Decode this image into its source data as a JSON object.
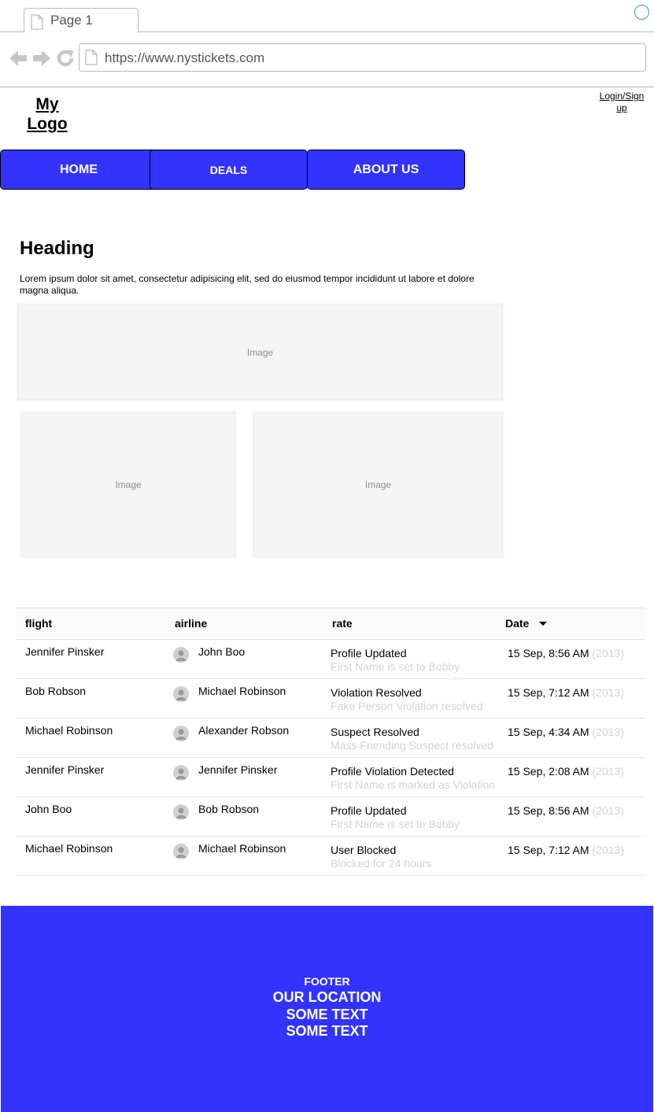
{
  "browser": {
    "tab_title": "Page 1",
    "url": "https://www.nystickets.com",
    "icons": [
      "document-icon",
      "back-arrow-icon",
      "forward-arrow-icon",
      "reload-icon"
    ]
  },
  "header": {
    "logo": "My Logo",
    "login": "Login/Sign up"
  },
  "menu": {
    "home": "HOME",
    "deals": "DEALS",
    "about": "ABOUT US",
    "color": "#3333ff"
  },
  "content": {
    "heading": "Heading",
    "paragraph": "Lorem ipsum dolor sit amet, consectetur adipisicing elit, sed do eiusmod tempor incididunt ut labore et dolore magna aliqua.",
    "image_label": "Image"
  },
  "table": {
    "headers": {
      "flight": "flight",
      "airline": "airline",
      "rate": "rate",
      "date": "Date"
    },
    "rows": [
      {
        "flight": "Jennifer Pinsker",
        "airline": "John Boo",
        "rate": "Profile Updated",
        "detail": "First Name is set to Bobby",
        "date": "15 Sep, 8:56 AM",
        "year": "(2013)"
      },
      {
        "flight": "Bob Robson",
        "airline": "Michael Robinson",
        "rate": "Violation Resolved",
        "detail": "Fake Person Violation resolved",
        "date": "15 Sep, 7:12 AM",
        "year": "(2013)"
      },
      {
        "flight": "Michael Robinson",
        "airline": "Alexander Robson",
        "rate": "Suspect Resolved",
        "detail": "Mass Friending Suspect resolved",
        "date": "15 Sep, 4:34 AM",
        "year": "(2013)"
      },
      {
        "flight": "Jennifer Pinsker",
        "airline": "Jennifer Pinsker",
        "rate": "Profile Violation Detected",
        "detail": "First Name is marked as Violation",
        "date": "15 Sep, 2:08 AM",
        "year": "(2013)"
      },
      {
        "flight": "John Boo",
        "airline": "Bob Robson",
        "rate": "Profile Updated",
        "detail": "First Name is set to Bobby",
        "date": "15 Sep, 8:56 AM",
        "year": "(2013)"
      },
      {
        "flight": "Michael Robinson",
        "airline": "Michael Robinson",
        "rate": "User Blocked",
        "detail": "Blocked for 24 hours",
        "date": "15 Sep, 7:12 AM",
        "year": "(2013)"
      }
    ]
  },
  "footer": {
    "label": "FOOTER",
    "line1": "OUR LOCATION",
    "line2": "SOME TEXT",
    "line3": "SOME TEXT",
    "color": "#3333ff"
  }
}
